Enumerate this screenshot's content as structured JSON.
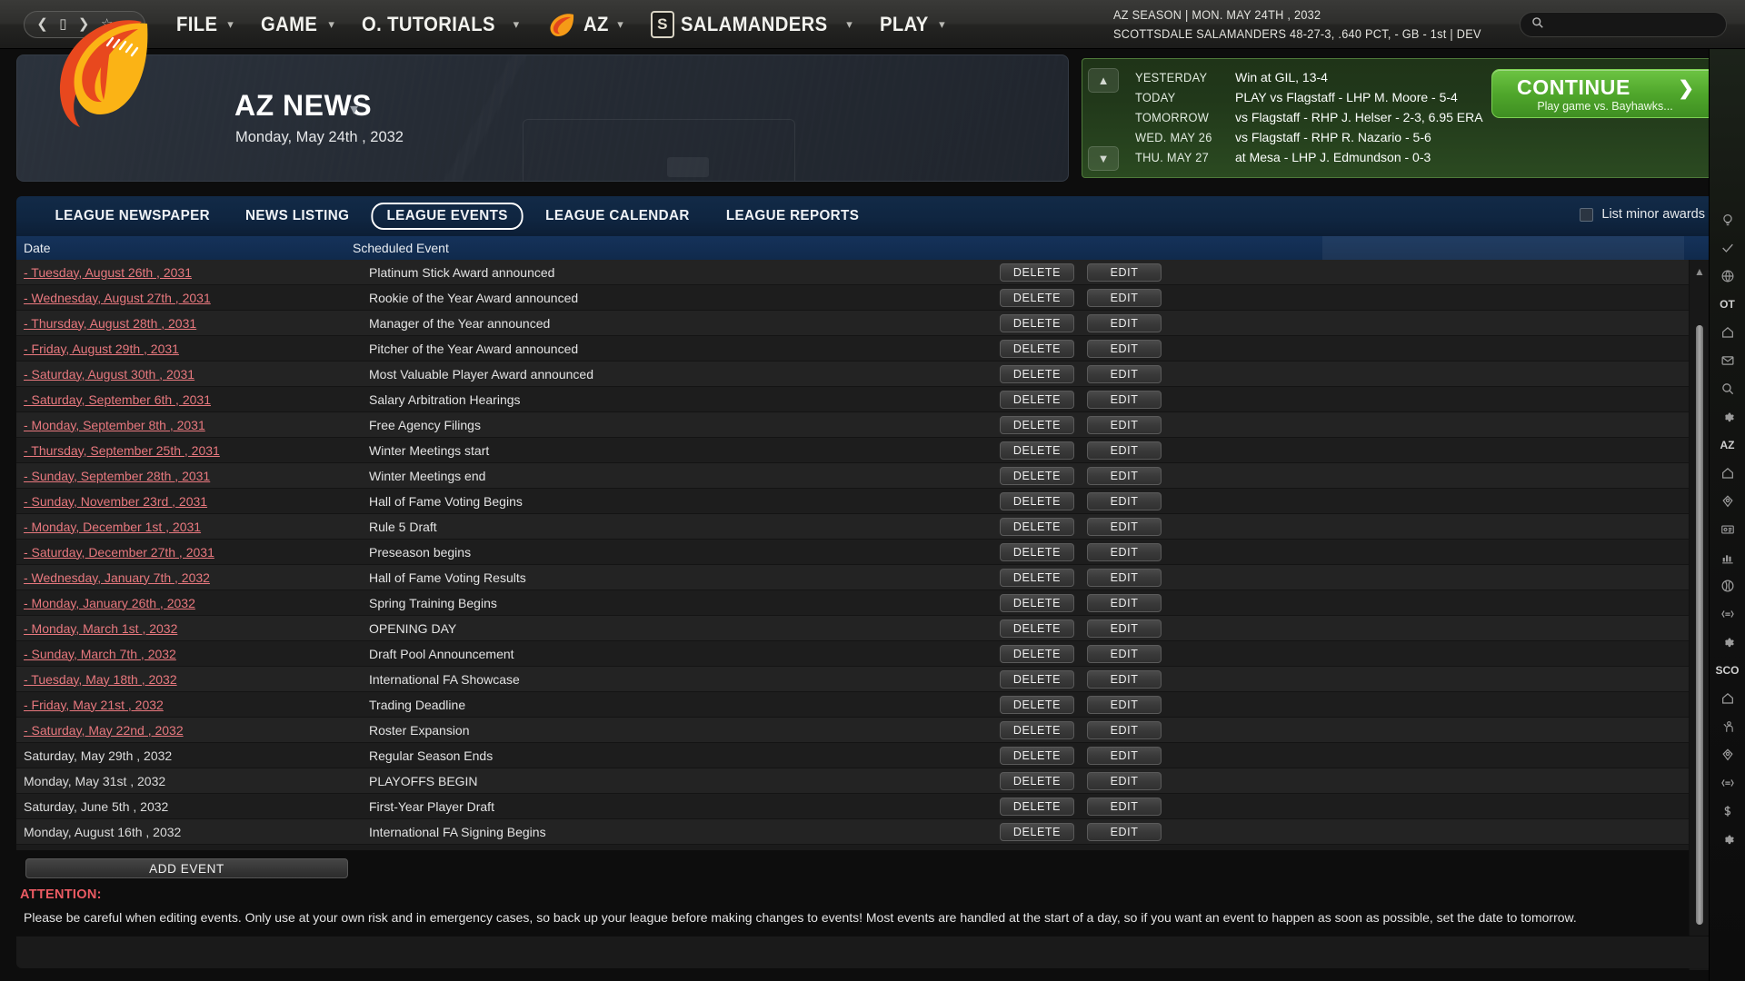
{
  "topbar": {
    "nav_icons": [
      "back-icon",
      "tablet-icon",
      "forward-icon",
      "star-icon",
      "home-icon"
    ],
    "menus": [
      {
        "label": "FILE",
        "icon": null
      },
      {
        "label": "GAME",
        "icon": null
      },
      {
        "label": "O. TUTORIALS",
        "icon": null
      },
      {
        "label": "AZ",
        "icon": "flame-logo"
      },
      {
        "label": "SALAMANDERS",
        "icon": "team-badge",
        "badge_text": "S"
      },
      {
        "label": "PLAY",
        "icon": null
      }
    ],
    "season_line1": "AZ SEASON  |  MON. MAY 24TH , 2032",
    "season_line2": "SCOTTSDALE SALAMANDERS   48-27-3, .640 PCT, - GB - 1st | DEV",
    "search_placeholder": ""
  },
  "banner": {
    "title": "AZ NEWS",
    "date": "Monday, May 24th , 2032",
    "logo": "flame-comet-logo"
  },
  "schedule": {
    "rows": [
      {
        "when": "YESTERDAY",
        "what": "Win at GIL, 13-4"
      },
      {
        "when": "TODAY",
        "what": "PLAY vs Flagstaff - LHP M. Moore - 5-4"
      },
      {
        "when": "TOMORROW",
        "what": "vs Flagstaff - RHP J. Helser - 2-3, 6.95 ERA"
      },
      {
        "when": "WED. MAY 26",
        "what": "vs Flagstaff - RHP R. Nazario - 5-6"
      },
      {
        "when": "THU. MAY 27",
        "what": "at Mesa - LHP J. Edmundson - 0-3"
      }
    ],
    "continue_label": "CONTINUE",
    "continue_sub": "Play game vs. Bayhawks...",
    "continue_color": "#4fa62b"
  },
  "tabs": [
    {
      "label": "LEAGUE NEWSPAPER",
      "active": false
    },
    {
      "label": "NEWS LISTING",
      "active": false
    },
    {
      "label": "LEAGUE EVENTS",
      "active": true
    },
    {
      "label": "LEAGUE CALENDAR",
      "active": false
    },
    {
      "label": "LEAGUE REPORTS",
      "active": false
    }
  ],
  "minor_awards": {
    "label": "List minor awards",
    "checked": false
  },
  "table": {
    "columns": [
      "Date",
      "Scheduled Event"
    ],
    "delete_label": "DELETE",
    "edit_label": "EDIT",
    "rows": [
      {
        "date": "- Tuesday, August 26th , 2031",
        "link": true,
        "event": "Platinum Stick Award announced"
      },
      {
        "date": "- Wednesday, August 27th , 2031",
        "link": true,
        "event": "Rookie of the Year Award announced"
      },
      {
        "date": "- Thursday, August 28th , 2031",
        "link": true,
        "event": "Manager of the Year announced"
      },
      {
        "date": "- Friday, August 29th , 2031",
        "link": true,
        "event": "Pitcher of the Year Award announced"
      },
      {
        "date": "- Saturday, August 30th , 2031",
        "link": true,
        "event": "Most Valuable Player Award announced"
      },
      {
        "date": "- Saturday, September 6th , 2031",
        "link": true,
        "event": "Salary Arbitration Hearings"
      },
      {
        "date": "- Monday, September 8th , 2031",
        "link": true,
        "event": "Free Agency Filings"
      },
      {
        "date": "- Thursday, September 25th , 2031",
        "link": true,
        "event": "Winter Meetings start"
      },
      {
        "date": "- Sunday, September 28th , 2031",
        "link": true,
        "event": "Winter Meetings end"
      },
      {
        "date": "- Sunday, November 23rd , 2031",
        "link": true,
        "event": "Hall of Fame Voting Begins"
      },
      {
        "date": "- Monday, December 1st , 2031",
        "link": true,
        "event": "Rule 5 Draft"
      },
      {
        "date": "- Saturday, December 27th , 2031",
        "link": true,
        "event": "Preseason begins"
      },
      {
        "date": "- Wednesday, January 7th , 2032",
        "link": true,
        "event": "Hall of Fame Voting Results"
      },
      {
        "date": "- Monday, January 26th , 2032",
        "link": true,
        "event": "Spring Training Begins"
      },
      {
        "date": "- Monday, March 1st , 2032",
        "link": true,
        "event": "OPENING DAY"
      },
      {
        "date": "- Sunday, March 7th , 2032",
        "link": true,
        "event": "Draft Pool Announcement"
      },
      {
        "date": "- Tuesday, May 18th , 2032",
        "link": true,
        "event": "International FA Showcase"
      },
      {
        "date": "- Friday, May 21st , 2032",
        "link": true,
        "event": "Trading Deadline"
      },
      {
        "date": "- Saturday, May 22nd , 2032",
        "link": true,
        "event": "Roster Expansion"
      },
      {
        "date": "Saturday, May 29th , 2032",
        "link": false,
        "event": "Regular Season Ends"
      },
      {
        "date": "Monday, May 31st , 2032",
        "link": false,
        "event": "PLAYOFFS BEGIN"
      },
      {
        "date": "Saturday, June 5th , 2032",
        "link": false,
        "event": "First-Year Player Draft"
      },
      {
        "date": "Monday, August 16th , 2032",
        "link": false,
        "event": "International FA Signing Begins"
      }
    ]
  },
  "footer": {
    "add_event_label": "ADD EVENT",
    "attention_title": "ATTENTION:",
    "attention_text": "Please be careful when editing events. Only use at your own risk and in emergency cases, so back up your league before making changes to events! Most events are handled at the start of a day, so if you want an event to happen as soon as possible, set the date to tomorrow.",
    "attention_color": "#ec5b63"
  },
  "rail": {
    "icons": [
      "lightbulb-icon",
      "check-icon",
      "globe-icon",
      "OT",
      "home-icon",
      "mail-icon",
      "search-icon",
      "gear-icon",
      "AZ",
      "home-icon",
      "location-pin-icon",
      "id-card-icon",
      "bar-chart-icon",
      "baseball-icon",
      "transaction-icon",
      "gear-icon",
      "SCO",
      "home-icon",
      "coach-icon",
      "location-pin-icon",
      "transaction-icon",
      "dollar-icon",
      "gear-icon"
    ]
  }
}
